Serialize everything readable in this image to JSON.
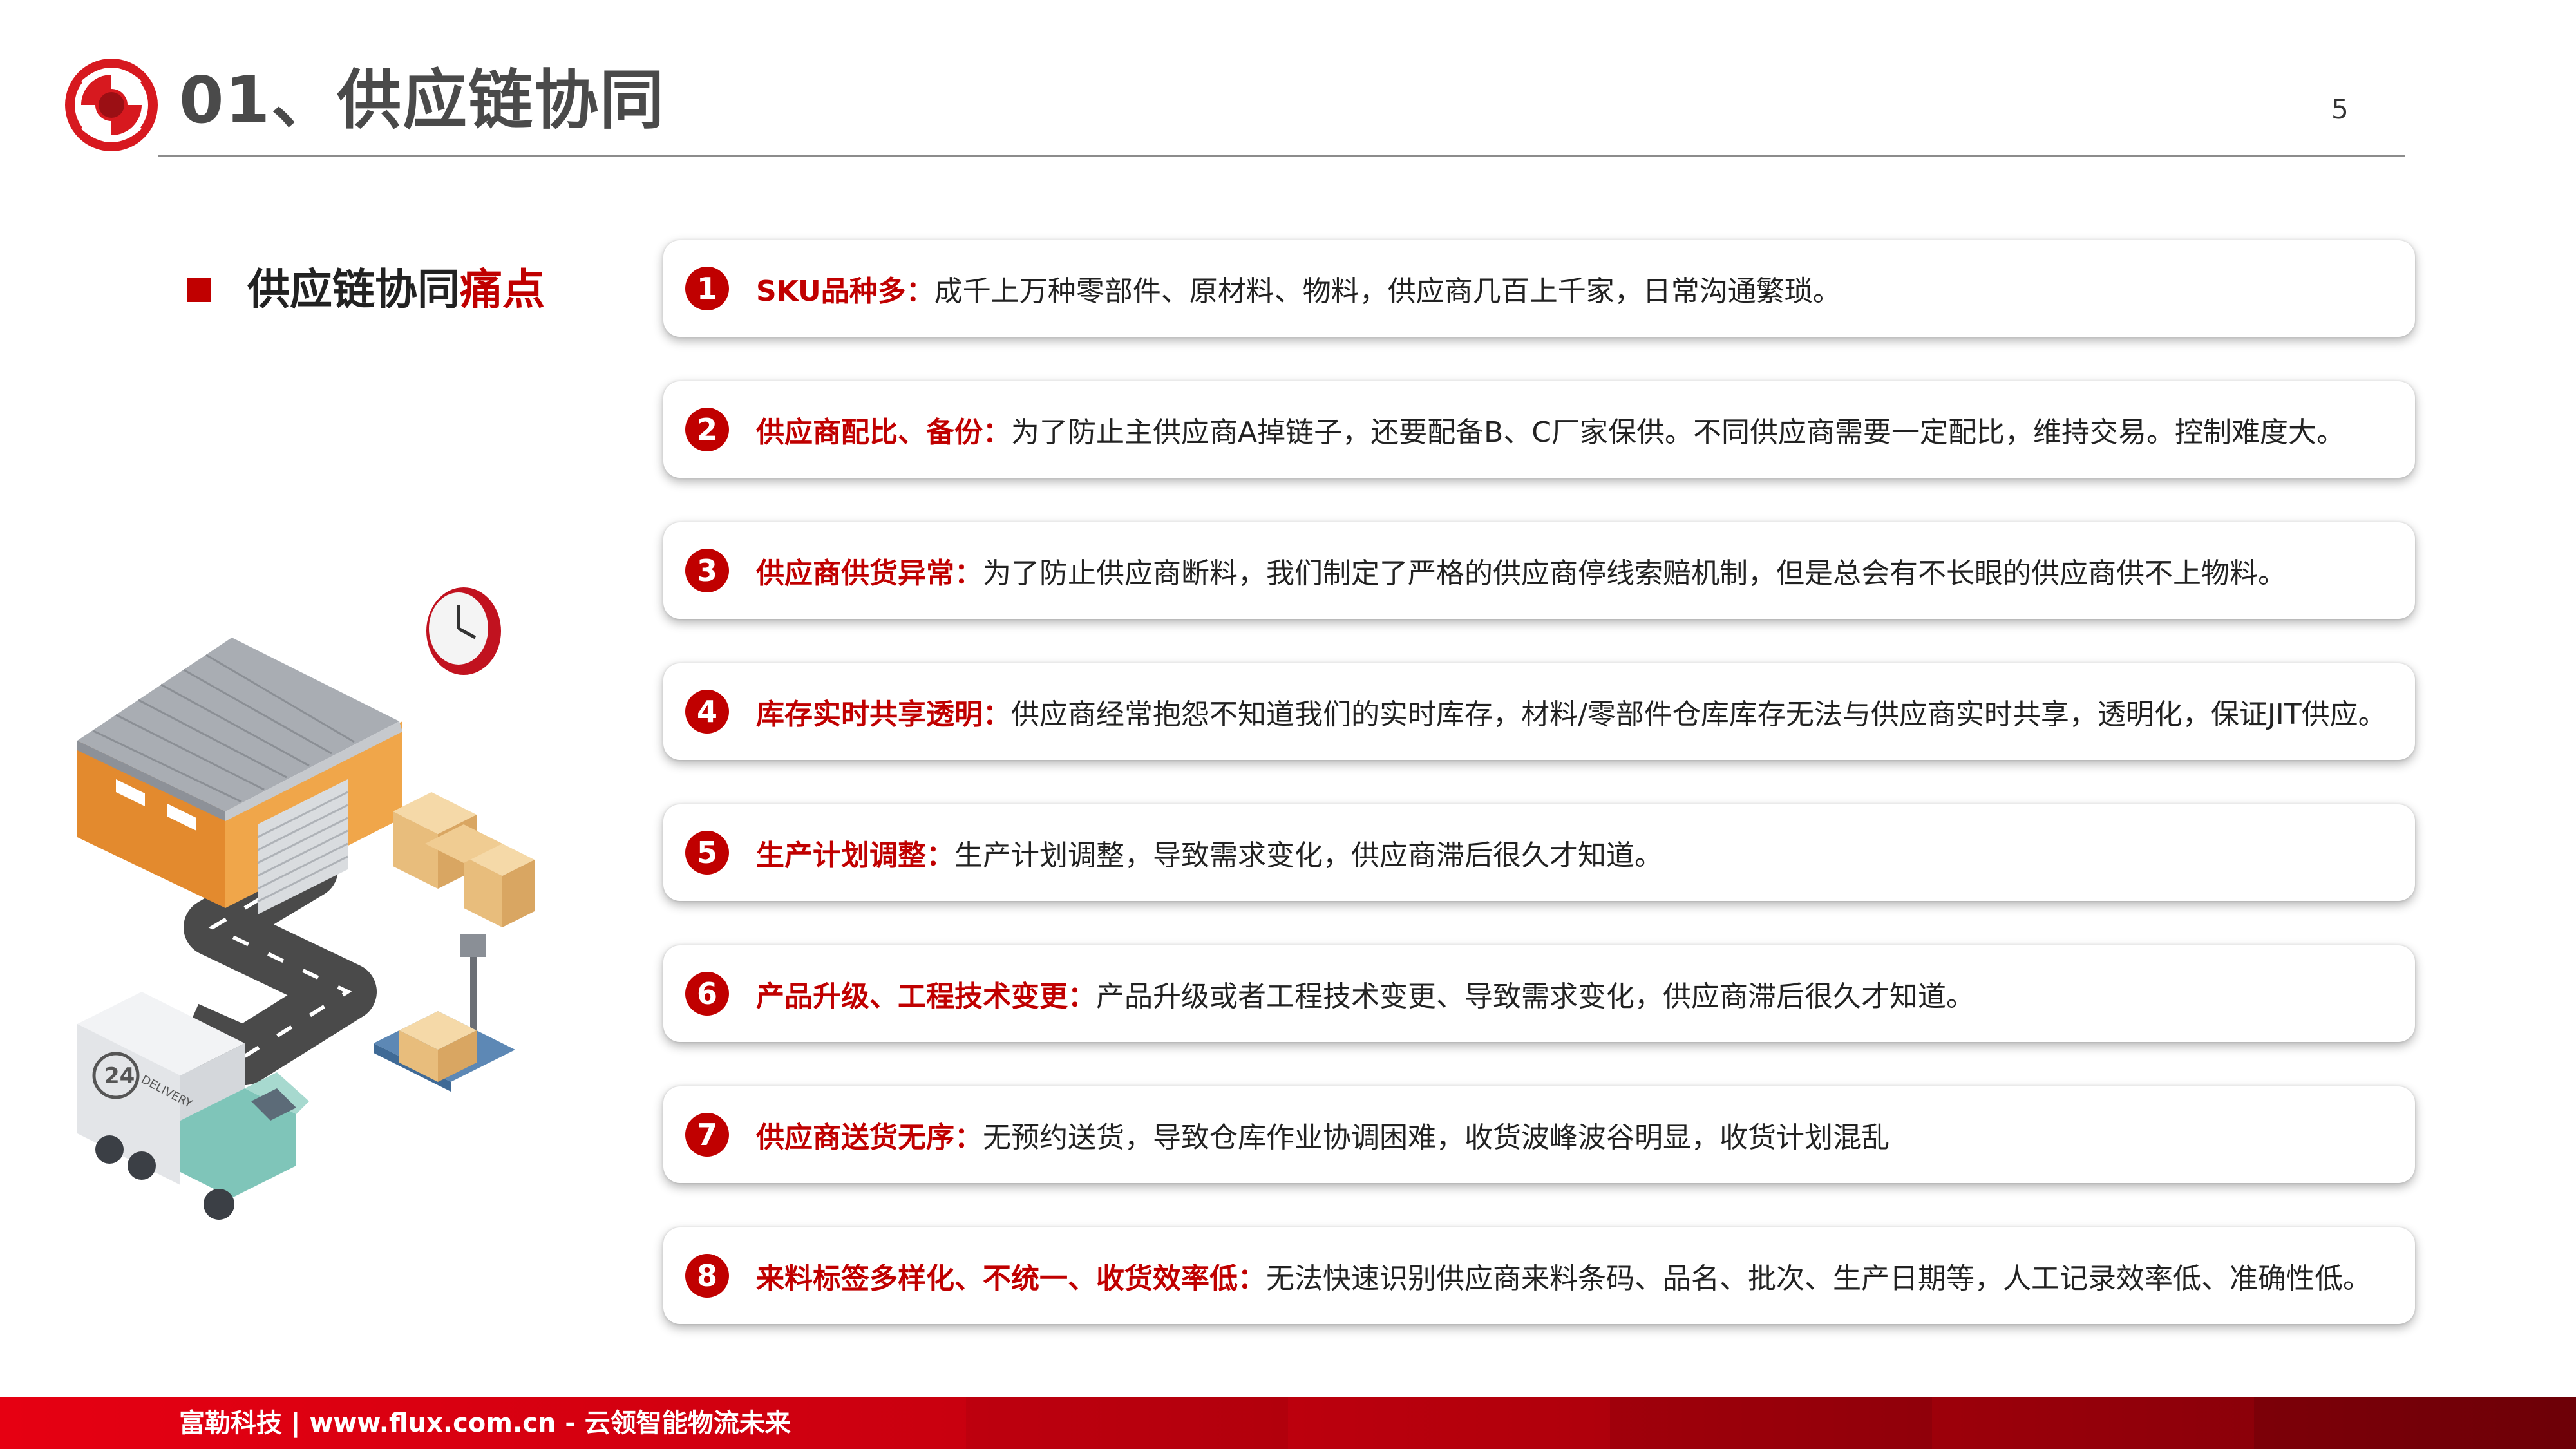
{
  "header": {
    "title": "01、供应链协同",
    "page_number": "5"
  },
  "section": {
    "label_main": "供应链协同",
    "label_accent": "痛点"
  },
  "illustration": {
    "truck_badge_number": "24",
    "truck_badge_text": "DELIVERY"
  },
  "rows": [
    {
      "num": "1",
      "title": "SKU品种多：",
      "desc": "成千上万种零部件、原材料、物料，供应商几百上千家，日常沟通繁琐。"
    },
    {
      "num": "2",
      "title": "供应商配比、备份：",
      "desc": "为了防止主供应商A掉链子，还要配备B、C厂家保供。不同供应商需要一定配比，维持交易。控制难度大。"
    },
    {
      "num": "3",
      "title": "供应商供货异常：",
      "desc": "为了防止供应商断料，我们制定了严格的供应商停线索赔机制，但是总会有不长眼的供应商供不上物料。"
    },
    {
      "num": "4",
      "title": "库存实时共享透明：",
      "desc": "供应商经常抱怨不知道我们的实时库存，材料/零部件仓库库存无法与供应商实时共享，透明化，保证JIT供应。"
    },
    {
      "num": "5",
      "title": "生产计划调整：",
      "desc": "生产计划调整，导致需求变化，供应商滞后很久才知道。"
    },
    {
      "num": "6",
      "title": "产品升级、工程技术变更：",
      "desc": "产品升级或者工程技术变更、导致需求变化，供应商滞后很久才知道。"
    },
    {
      "num": "7",
      "title": "供应商送货无序：",
      "desc": "无预约送货，导致仓库作业协调困难，收货波峰波谷明显，收货计划混乱"
    },
    {
      "num": "8",
      "title": "来料标签多样化、不统一、收货效率低：",
      "desc": "无法快速识别供应商来料条码、品名、批次、生产日期等，人工记录效率低、准确性低。"
    }
  ],
  "footer": {
    "text": "富勒科技 | www.flux.com.cn  -  云领智能物流未来"
  },
  "colors": {
    "accent": "#c00000",
    "title_gray": "#4a4a4a",
    "footer_red": "#e60012",
    "footer_dark": "#7a0008"
  }
}
